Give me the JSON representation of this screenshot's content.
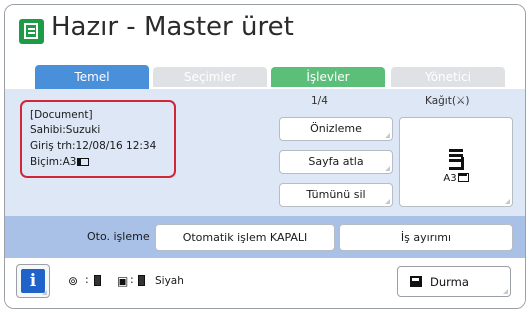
{
  "title": {
    "text": "Hazır - Master üret",
    "icon": "master-make-icon",
    "icon_color": "#1f9a46"
  },
  "tabs": [
    {
      "label": "Temel",
      "active": true,
      "color": "#4a8fd9"
    },
    {
      "label": "Seçimler",
      "active": false,
      "color": "#dfe1e4"
    },
    {
      "label": "İşlevler",
      "active": false,
      "color": "#5bbf7a"
    },
    {
      "label": "Yönetici",
      "active": false,
      "color": "#dfe1e4"
    }
  ],
  "document_info": {
    "name": "[Document]",
    "owner": "Sahibi:Suzuki",
    "date": "Giriş trh:12/08/16 12:34",
    "format": "Biçim:A3",
    "format_icon": "portrait-paper-icon",
    "highlight_color": "#d0263a"
  },
  "pages": {
    "counter": "1/4"
  },
  "buttons": {
    "preview": "Önizleme",
    "skip_page": "Sayfa atla",
    "delete_all": "Tümünü sil"
  },
  "paper": {
    "label": "Kağıt(",
    "label_icon": "⚔",
    "label_end": ")",
    "tray_icon": "paper-tray-icon",
    "size": "A3",
    "size_icon": "landscape-paper-icon"
  },
  "auto_process": {
    "label": "Oto. işleme",
    "value": "Otomatik işlem KAPALI",
    "job_separator": "İş ayırımı"
  },
  "status": {
    "info_icon": "i",
    "ink_icon": "ink-drum-icon",
    "master_icon": "master-roll-icon",
    "colon": ":",
    "ink_color": "Siyah",
    "stop": "Durma"
  }
}
